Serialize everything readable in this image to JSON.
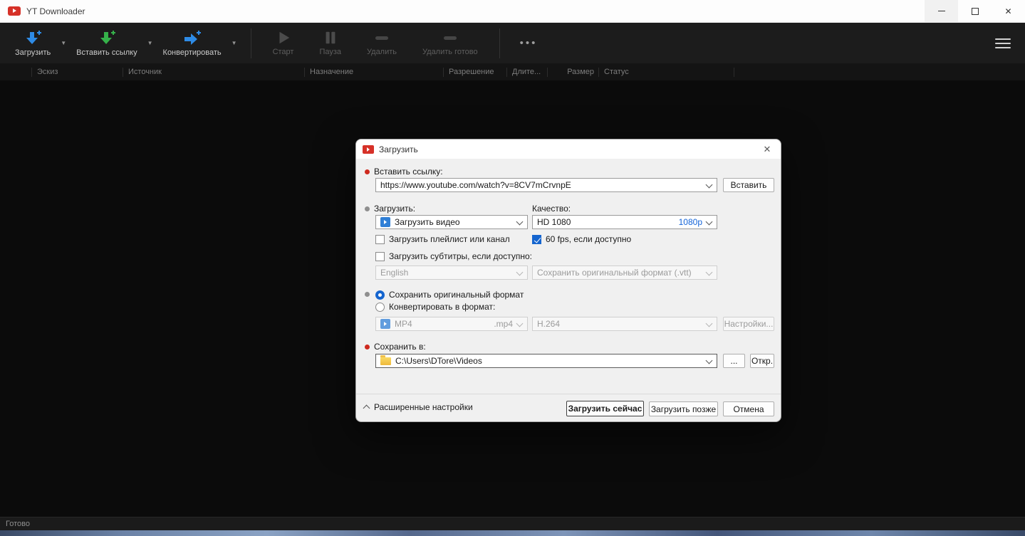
{
  "window": {
    "title": "YT Downloader",
    "status_text": "Готово"
  },
  "toolbar": {
    "download": "Загрузить",
    "paste_link": "Вставить ссылку",
    "convert": "Конвертировать",
    "start": "Старт",
    "pause": "Пауза",
    "delete": "Удалить",
    "delete_done": "Удалить готово",
    "more": "•••"
  },
  "list": {
    "columns": [
      "Эскиз",
      "Источник",
      "Назначение",
      "Разрешение",
      "Длите...",
      "Размер",
      "Статус"
    ]
  },
  "dialog": {
    "title": "Загрузить",
    "paste_link_label": "Вставить ссылку:",
    "url": "https://www.youtube.com/watch?v=8CV7mCrvnpE",
    "paste_button": "Вставить",
    "download_label": "Загрузить:",
    "quality_label": "Качество:",
    "download_mode": "Загрузить видео",
    "quality_value": "HD 1080",
    "quality_res": "1080p",
    "playlist_checkbox": "Загрузить плейлист или канал",
    "fps_checkbox": "60 fps, если доступно",
    "subtitles_checkbox": "Загрузить субтитры, если доступно:",
    "subtitle_language": "English",
    "subtitle_format": "Сохранить оригинальный формат (.vtt)",
    "keep_original_radio": "Сохранить оригинальный формат",
    "convert_radio": "Конвертировать в формат:",
    "container_format": "MP4",
    "container_ext": ".mp4",
    "codec": "H.264",
    "settings_button": "Настройки...",
    "save_to_label": "Сохранить в:",
    "save_path": "C:\\Users\\DTore\\Videos",
    "browse_button": "...",
    "open_button": "Откр.",
    "advanced_settings": "Расширенные настройки",
    "download_now": "Загрузить сейчас",
    "download_later": "Загрузить позже",
    "cancel": "Отмена"
  },
  "colors": {
    "accent_blue": "#1565cf",
    "brand_red": "#d63128",
    "toolbar_bg": "#1c1c1c"
  }
}
